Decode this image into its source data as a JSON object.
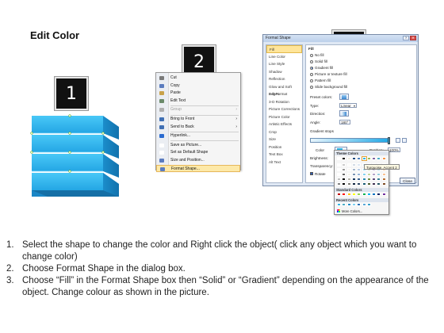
{
  "title": "Edit Color",
  "steps": {
    "one": "1",
    "two": "2",
    "three": "3"
  },
  "context_menu": {
    "items": [
      {
        "label": "Cut",
        "disabled": false,
        "icon_color": "#7a7a7a"
      },
      {
        "label": "Copy",
        "disabled": false,
        "icon_color": "#5a7bbf"
      },
      {
        "label": "Paste",
        "disabled": false,
        "icon_color": "#c9a24a"
      },
      {
        "label": "Edit Text",
        "disabled": false,
        "icon_color": "#6a8a6a"
      },
      {
        "label": "Group",
        "disabled": true,
        "icon_color": "#b0b0b0"
      },
      {
        "label": "Bring to Front",
        "disabled": false,
        "icon_color": "#3f6fb4"
      },
      {
        "label": "Send to Back",
        "disabled": false,
        "icon_color": "#3f6fb4"
      },
      {
        "label": "Hyperlink...",
        "disabled": false,
        "icon_color": "#2a6bd0"
      },
      {
        "label": "Save as Picture...",
        "disabled": false,
        "icon_color": "#ffffff"
      },
      {
        "label": "Set as Default Shape",
        "disabled": false,
        "icon_color": "#ffffff"
      },
      {
        "label": "Size and Position...",
        "disabled": false,
        "icon_color": "#5a7bbf"
      },
      {
        "label": "Format Shape...",
        "disabled": false,
        "icon_color": "#5a7bbf"
      }
    ],
    "highlighted": "Format Shape..."
  },
  "dialog": {
    "title": "Format Shape",
    "nav": [
      "Fill",
      "Line Color",
      "Line Style",
      "Shadow",
      "Reflection",
      "Glow and Soft Edges",
      "3-D Format",
      "3-D Rotation",
      "Picture Corrections",
      "Picture Color",
      "Artistic Effects",
      "Crop",
      "Size",
      "Position",
      "Text Box",
      "Alt Text"
    ],
    "selected_nav": "Fill",
    "fill": {
      "heading": "Fill",
      "options": [
        "No fill",
        "Solid fill",
        "Gradient fill",
        "Picture or texture fill",
        "Pattern fill",
        "Slide background fill"
      ],
      "selected": "Gradient fill",
      "preset_label": "Preset colors:",
      "type_label": "Type:",
      "type_value": "Linear",
      "direction_label": "Direction:",
      "angle_label": "Angle:",
      "angle_value": "180°",
      "stops_label": "Gradient stops",
      "color_label": "Color",
      "position_label": "Position:",
      "position_value": "100%",
      "brightness_label": "Brightness:",
      "transparency_label": "Transparency:",
      "rotate_label": "Rotate",
      "close_label": "Close"
    }
  },
  "color_popup": {
    "theme_header": "Theme Colors",
    "standard_header": "Standard Colors",
    "recent_header": "Recent Colors",
    "more_label": "More Colors...",
    "tooltip": "Turquoise, Accent 2",
    "theme_top": [
      "#ffffff",
      "#000000",
      "#eeece1",
      "#1f497d",
      "#4f81bd",
      "#31b6e7",
      "#9bbb59",
      "#8064a2",
      "#4bacc6",
      "#f79646"
    ],
    "standard": [
      "#c00000",
      "#ff0000",
      "#ffc000",
      "#ffff00",
      "#92d050",
      "#00b050",
      "#00b0f0",
      "#0070c0",
      "#002060",
      "#7030a0"
    ],
    "recent": [
      "#31b6e7",
      "#4bacc6",
      "#1f8fc8",
      "#7fd0f0",
      "#2a6fb5",
      "#5aa7d8",
      "#39a0c9"
    ]
  },
  "instructions": [
    {
      "num": "1.",
      "text": "Select the shape to change the color and Right click the object( click any object which you want to change color)"
    },
    {
      "num": "2.",
      "text": "Choose Format Shape in the dialog box."
    },
    {
      "num": "3.",
      "text": "Choose “Fill” in the Format Shape box then “Solid” or “Gradient” depending on the appearance of the object. Change colour as shown in the picture."
    }
  ],
  "colors": {
    "shape_light": "#3ec0f3",
    "shape_dark": "#1683bf",
    "badge": "#111111",
    "highlight": "#fde9a8"
  }
}
